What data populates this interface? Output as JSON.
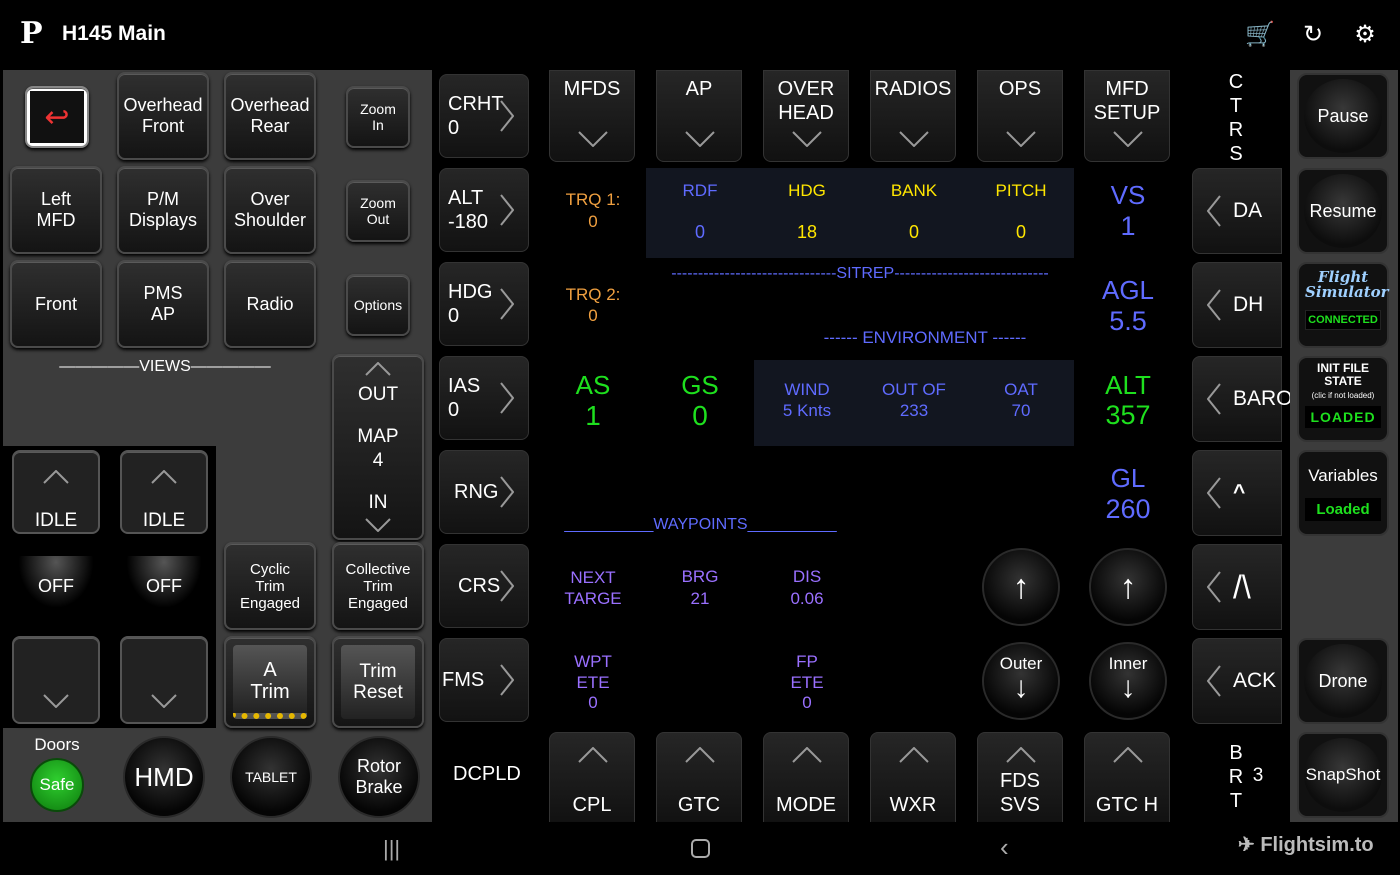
{
  "app": {
    "title": "H145 Main",
    "logo": "P"
  },
  "topbar": {
    "icons": [
      "cart-icon",
      "refresh-icon",
      "settings-icon"
    ]
  },
  "left": {
    "back_icon": "back-arrow-icon",
    "buttons": {
      "overhead_front": "Overhead\nFront",
      "overhead_rear": "Overhead\nRear",
      "zoom_in": "Zoom\nIn",
      "left_mfd": "Left\nMFD",
      "pm_displays": "P/M\nDisplays",
      "over_shoulder": "Over\nShoulder",
      "zoom_out": "Zoom\nOut",
      "front": "Front",
      "pms_ap": "PMS\nAP",
      "radio": "Radio",
      "options": "Options"
    },
    "views_label": "—————VIEWS—————",
    "map": {
      "out": "OUT",
      "map": "MAP",
      "value": "4",
      "in": "IN"
    },
    "idle1": "IDLE",
    "idle2": "IDLE",
    "off1": "OFF",
    "off2": "OFF",
    "cyclic": "Cyclic\nTrim\nEngaged",
    "collective": "Collective\nTrim\nEngaged",
    "a_trim": "A\nTrim",
    "trim_reset": "Trim\nReset",
    "doors": "Doors",
    "safe": "Safe",
    "hmd": "HMD",
    "tablet": "TABLET",
    "rotor_brake": "Rotor\nBrake"
  },
  "column": {
    "crht": "CRHT\n0",
    "alt": "ALT\n-180",
    "hdg": "HDG\n0",
    "ias": "IAS\n0",
    "rng": "RNG",
    "crs": "CRS",
    "fms": "FMS",
    "dcpld": "DCPLD"
  },
  "topkeys": [
    "MFDS",
    "AP",
    "OVER\nHEAD",
    "RADIOS",
    "OPS",
    "MFD\nSETUP"
  ],
  "ctrs": "C\nT\nR\nS",
  "readouts": {
    "trq1_label": "TRQ 1:",
    "trq1_value": "0",
    "trq2_label": "TRQ 2:",
    "trq2_value": "0",
    "rdf_label": "RDF",
    "rdf_value": "0",
    "hdg_label": "HDG",
    "hdg_value": "18",
    "bank_label": "BANK",
    "bank_value": "0",
    "pitch_label": "PITCH",
    "pitch_value": "0",
    "sitrep": "-------------------------------SITREP-----------------------------",
    "environment": "------ ENVIRONMENT ------",
    "as_label": "AS",
    "as_value": "1",
    "gs_label": "GS",
    "gs_value": "0",
    "wind_label": "WIND",
    "wind_value": "5 Knts",
    "outof_label": "OUT OF",
    "outof_value": "233",
    "oat_label": "OAT",
    "oat_value": "70",
    "waypoints": "__________WAYPOINTS__________",
    "next_label": "NEXT\nTARGE",
    "brg_label": "BRG",
    "brg_value": "21",
    "dis_label": "DIS",
    "dis_value": "0.06",
    "wpt_label": "WPT\nETE",
    "wpt_value": "0",
    "fp_label": "FP\nETE",
    "fp_value": "0",
    "vs_label": "VS",
    "vs_value": "1",
    "agl_label": "AGL",
    "agl_value": "5.5",
    "alt_label": "ALT",
    "alt_value": "357",
    "gl_label": "GL",
    "gl_value": "260"
  },
  "knobs": {
    "outer": "Outer",
    "inner": "Inner"
  },
  "botkeys": [
    "CPL",
    "GTC",
    "MODE",
    "WXR",
    "FDS\nSVS",
    "GTC H"
  ],
  "rightkeys": [
    "DA",
    "DH",
    "BARO",
    "^",
    "/\\",
    "ACK"
  ],
  "brt": {
    "letters": "B\nR\nT",
    "value": "3"
  },
  "far_right": {
    "pause": "Pause",
    "resume": "Resume",
    "connected": "CONNECTED",
    "fs_logo": "Flight\nSimulator",
    "init_title": "INIT FILE\nSTATE",
    "init_sub": "(clic if not loaded)",
    "loaded": "LOADED",
    "variables": "Variables",
    "variables_loaded": "Loaded",
    "drone": "Drone",
    "snapshot": "SnapShot"
  },
  "watermark": "Flightsim.to",
  "navbar": {
    "icons": [
      "recent-apps-icon",
      "home-icon",
      "back-icon"
    ]
  },
  "colors": {
    "orange": "#f0a040",
    "blue": "#5f6bff",
    "yellow": "#ffe600",
    "green": "#1ee01e",
    "purple": "#9a70ff",
    "safe": "#1fa21f"
  }
}
